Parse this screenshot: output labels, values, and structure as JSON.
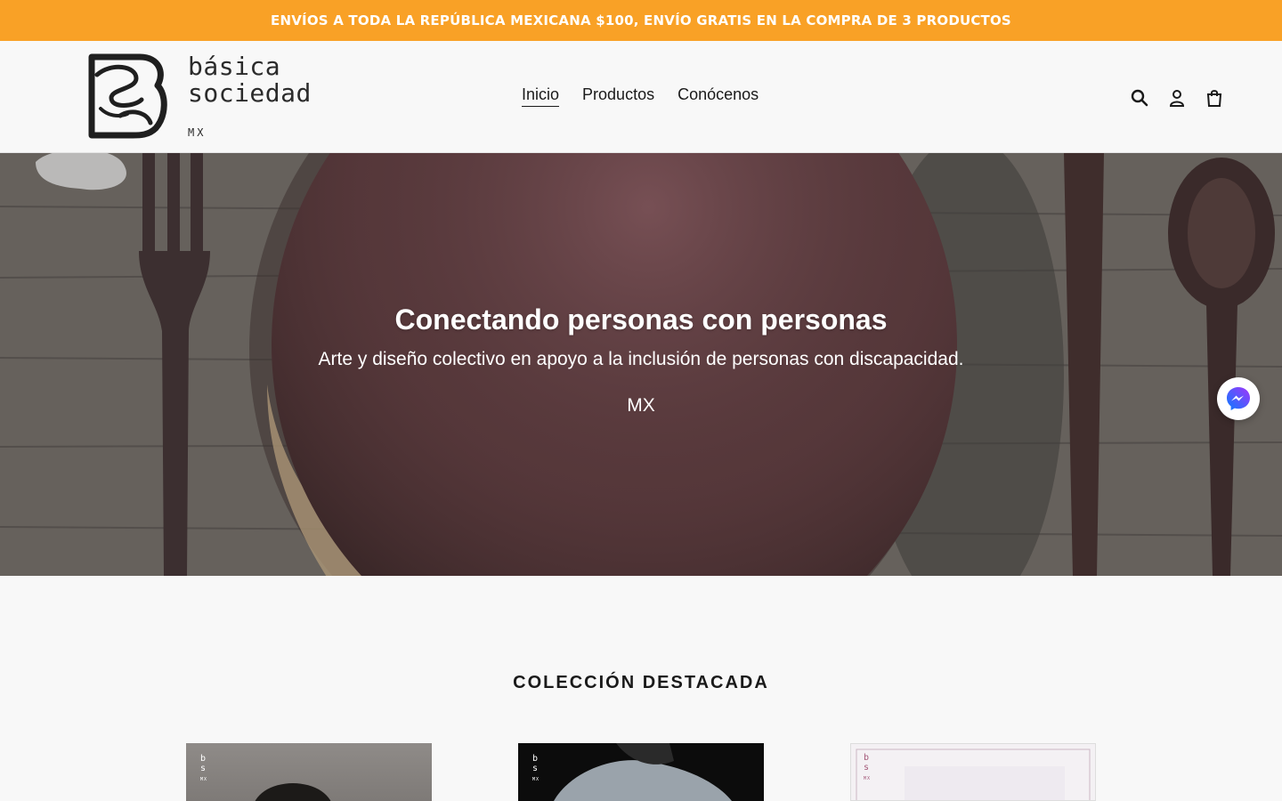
{
  "announcement": {
    "text": "ENVÍOS A TODA LA REPÚBLICA MEXICANA $100, ENVÍO GRATIS EN LA COMPRA DE 3 PRODUCTOS"
  },
  "logo": {
    "line1": "básica",
    "line2": "sociedad",
    "region": "MX"
  },
  "nav": {
    "items": [
      {
        "label": "Inicio",
        "active": true
      },
      {
        "label": "Productos"
      },
      {
        "label": "Conócenos"
      }
    ]
  },
  "header_icons": [
    "search-icon",
    "account-icon",
    "cart-icon"
  ],
  "hero": {
    "title": "Conectando personas con personas",
    "subtitle": "Arte y diseño colectivo en apoyo a la inclusión de personas con discapacidad.",
    "region": "MX"
  },
  "messenger": {
    "icon": "messenger-icon"
  },
  "featured": {
    "title": "COLECCIÓN DESTACADA",
    "products": [
      {
        "mark_top": "b",
        "mark_bottom": "s",
        "mark_region": "MX"
      },
      {
        "mark_top": "b",
        "mark_bottom": "s",
        "mark_region": "MX"
      },
      {
        "mark_top": "b",
        "mark_bottom": "s",
        "mark_region": "MX"
      }
    ]
  },
  "colors": {
    "announcement_bg": "#f9a126",
    "page_bg": "#f8f8f8",
    "text": "#1a1a1a",
    "messenger_blue": "#1877f2"
  }
}
